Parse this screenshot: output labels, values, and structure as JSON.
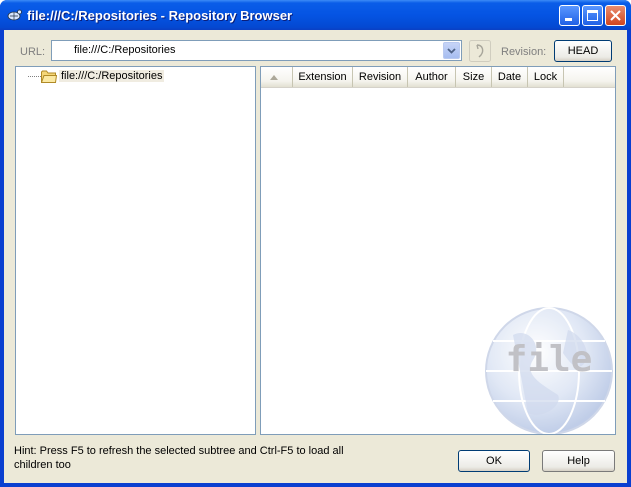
{
  "window": {
    "title": "file:///C:/Repositories - Repository Browser"
  },
  "url_bar": {
    "label": "URL:",
    "value": "file:///C:/Repositories"
  },
  "revision": {
    "label": "Revision:",
    "button": "HEAD"
  },
  "tree": {
    "root": "file:///C:/Repositories"
  },
  "list": {
    "columns": [
      "",
      "Extension",
      "Revision",
      "Author",
      "Size",
      "Date",
      "Lock"
    ]
  },
  "watermark": {
    "text": "file"
  },
  "hint": "Hint: Press F5 to refresh the selected subtree and Ctrl-F5 to load all children too",
  "buttons": {
    "ok": "OK",
    "help": "Help"
  },
  "colors": {
    "titlebar": "#0554e3",
    "face": "#ece9d8",
    "border": "#7f9db9"
  }
}
